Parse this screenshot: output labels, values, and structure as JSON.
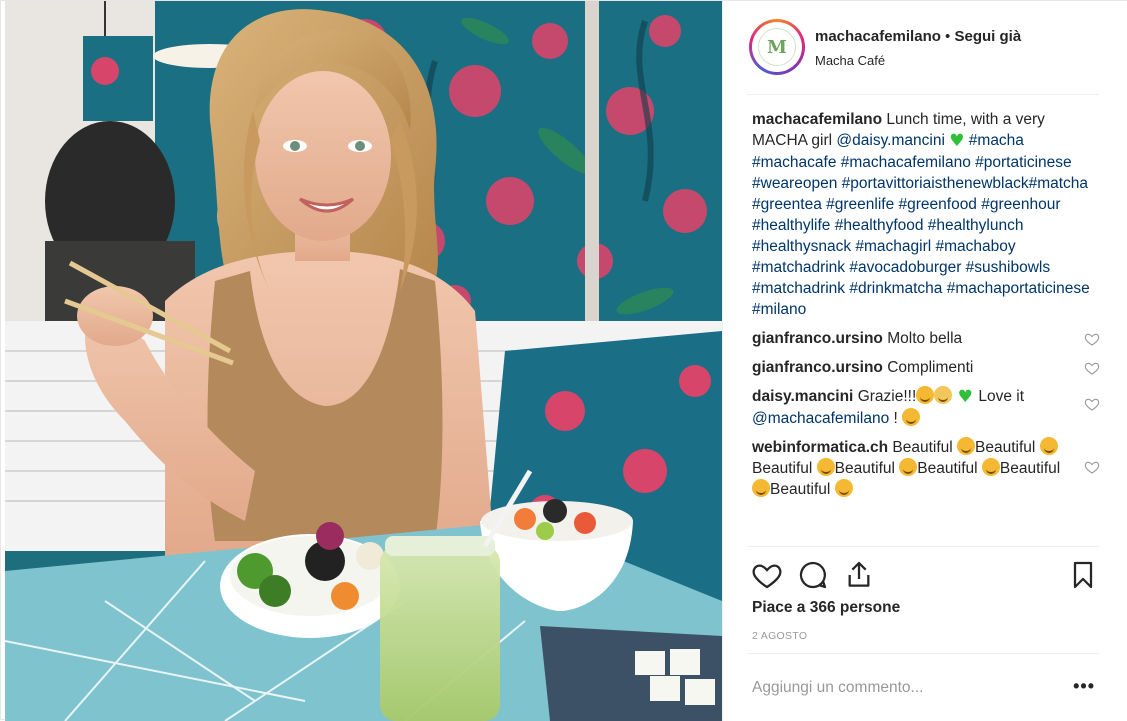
{
  "header": {
    "username": "machacafemilano",
    "separator": " • ",
    "follow_label": "Segui già",
    "location": "Macha Café",
    "avatar_letter": "M"
  },
  "caption": {
    "username": "machacafemilano",
    "text_before": " Lunch time, with a very MACHA girl ",
    "mention": "@daisy.mancini",
    "hashtags": "#macha #machacafe #machacafemilano #portaticinese #weareopen #portavittoriaisthenewblack#matcha #greentea #greenlife #greenfood #greenhour #healthylife #healthyfood #healthylunch #healthysnack #machagirl #machaboy #matchadrink #avocadoburger #sushibowls #matchadrink #drinkmatcha #machaportaticinese #milano"
  },
  "comments": [
    {
      "user": "gianfranco.ursino",
      "text": "Molto bella"
    },
    {
      "user": "gianfranco.ursino",
      "text": "Complimenti"
    },
    {
      "user": "daisy.mancini",
      "text": "Grazie!!!",
      "text_after": "Love it",
      "mention": "@machacafemilano",
      "tail": " !"
    },
    {
      "user": "webinformatica.ch",
      "word": "Beautiful"
    }
  ],
  "likes": "Piace a 366 persone",
  "date": "2 AGOSTO",
  "add_comment_placeholder": "Aggiungi un commento...",
  "more_label": "•••",
  "icons": [
    "heart-icon",
    "comment-icon",
    "share-icon",
    "bookmark-icon",
    "small-heart-icon"
  ],
  "colors": {
    "link": "#003569",
    "muted": "#999999",
    "text": "#262626",
    "emoji_heart": "#2fbf3a"
  }
}
